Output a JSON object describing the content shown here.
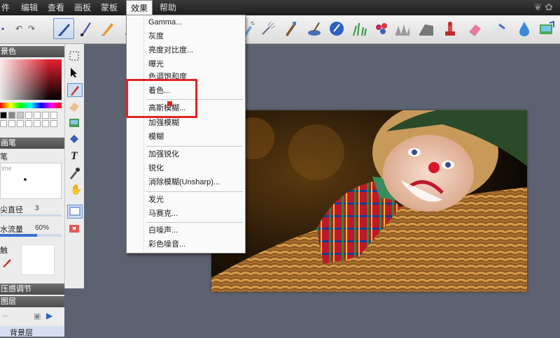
{
  "menubar": {
    "items": [
      {
        "label": "件"
      },
      {
        "label": "编辑"
      },
      {
        "label": "查看"
      },
      {
        "label": "画板"
      },
      {
        "label": "蒙板"
      },
      {
        "label": "效果"
      },
      {
        "label": "帮助"
      }
    ]
  },
  "effects_menu": {
    "items": [
      {
        "label": "Gamma..."
      },
      {
        "label": "灰度"
      },
      {
        "label": "亮度对比度..."
      },
      {
        "label": "曝光"
      },
      {
        "label": "色调饱和度"
      },
      {
        "label": "着色..."
      },
      {
        "label": "高斯模糊..."
      },
      {
        "label": "加强模糊"
      },
      {
        "label": "模糊"
      },
      {
        "label": "加强锐化"
      },
      {
        "label": "锐化"
      },
      {
        "label": "消除模糊(Unsharp)..."
      },
      {
        "label": "发光"
      },
      {
        "label": "马赛克..."
      },
      {
        "label": "白噪声..."
      },
      {
        "label": "彩色噪音..."
      }
    ]
  },
  "left_panel": {
    "color_header": "景色",
    "brush_header": "画笔",
    "brush_sub": "笔",
    "preview_text": "ime",
    "tip_diameter_label": "尖直径",
    "tip_diameter_value": "3",
    "water_flow_label": "水流量",
    "water_flow_value": "60%",
    "material_label": "触",
    "pressure_header": "压感调节",
    "layers_header": "图层",
    "layer_name": "背景层",
    "water_flow_level": 0.6
  },
  "colors": {
    "accent_red": "#e02424",
    "menubar_bg": "#1e1e1e",
    "canvas_bg": "#5d6270"
  }
}
